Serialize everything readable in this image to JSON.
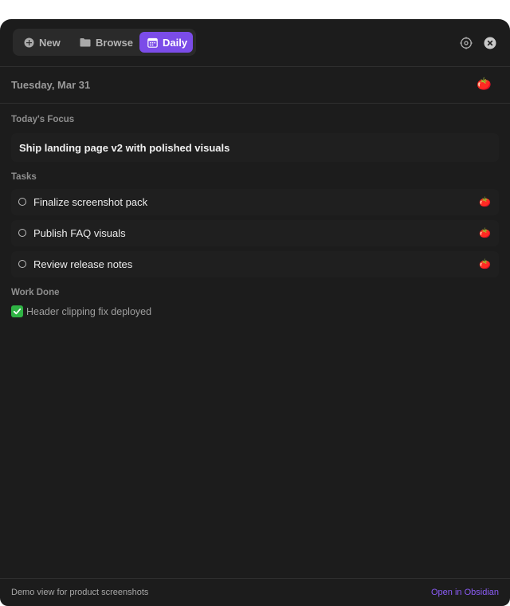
{
  "toolbar": {
    "tabs": [
      {
        "label": "New",
        "icon": "plus-circle-icon"
      },
      {
        "label": "Browse",
        "icon": "folder-icon"
      },
      {
        "label": "Daily",
        "icon": "calendar-icon",
        "active": true
      }
    ],
    "settings_icon": "gear-icon",
    "close_icon": "close-icon",
    "accent_color": "#7b4ce8"
  },
  "date": {
    "text": "Tuesday, Mar 31",
    "icon": "tomato-icon"
  },
  "focus": {
    "heading": "Today's Focus",
    "text": "Ship landing page v2 with polished visuals"
  },
  "tasks": {
    "heading": "Tasks",
    "items": [
      {
        "label": "Finalize screenshot pack",
        "icon": "tomato-icon"
      },
      {
        "label": "Publish FAQ visuals",
        "icon": "tomato-icon"
      },
      {
        "label": "Review release notes",
        "icon": "tomato-icon"
      }
    ]
  },
  "work_done": {
    "heading": "Work Done",
    "items": [
      {
        "label": "Header clipping fix deployed",
        "icon": "check-icon"
      }
    ]
  },
  "footer": {
    "note": "Demo view for product screenshots",
    "link": "Open in Obsidian",
    "link_color": "#8b5cf6"
  }
}
